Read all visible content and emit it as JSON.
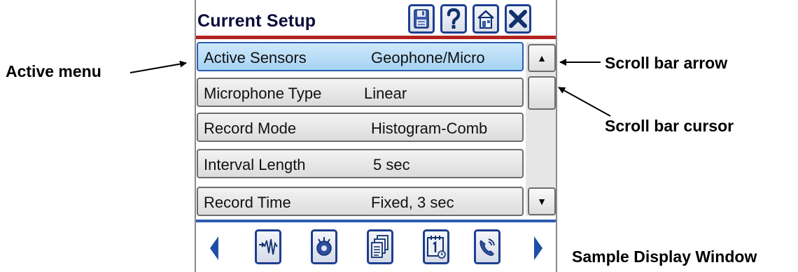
{
  "window": {
    "title": "Current Setup",
    "toolbar_icons": [
      "save-icon",
      "help-icon",
      "home-icon",
      "close-icon"
    ],
    "colors": {
      "title_text": "#0b0b3a",
      "icon_border": "#1d3f8f",
      "title_rule": "#b3231f",
      "active_row": "#a6d3f4",
      "nav_rule": "#2a5db0"
    }
  },
  "setup_rows": [
    {
      "label": "Active Sensors",
      "value": "Geophone/Micro",
      "active": true
    },
    {
      "label": "Microphone Type",
      "value": "Linear",
      "active": false
    },
    {
      "label": "Record Mode",
      "value": "Histogram-Comb",
      "active": false
    },
    {
      "label": "Interval Length",
      "value": "5 sec",
      "active": false
    },
    {
      "label": "Record Time",
      "value": "Fixed, 3 sec",
      "active": false
    }
  ],
  "scrollbar": {
    "up_glyph": "▲",
    "down_glyph": "▼"
  },
  "bottom_nav": {
    "icons": [
      "waveform-icon",
      "sensor-icon",
      "documents-icon",
      "calendar-icon",
      "phone-icon"
    ],
    "prev_icon": "left-triangle-icon",
    "next_icon": "right-triangle-icon"
  },
  "annotations": {
    "active_menu": "Active menu",
    "scroll_bar_arrow": "Scroll bar arrow",
    "scroll_bar_cursor": "Scroll bar cursor",
    "sample_display_window": "Sample Display Window"
  }
}
